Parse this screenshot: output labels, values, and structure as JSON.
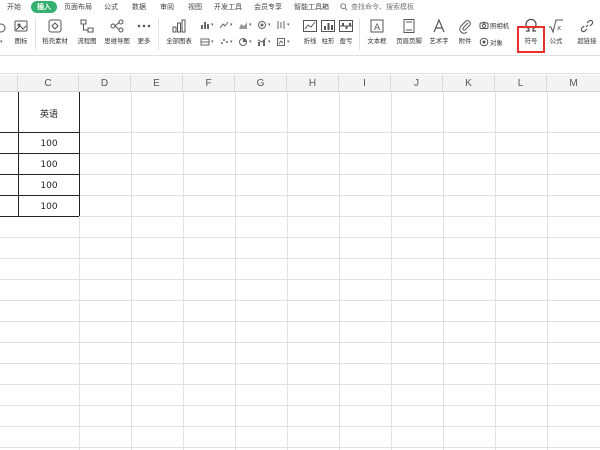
{
  "menu": {
    "tabs": [
      "开始",
      "插入",
      "页面布局",
      "公式",
      "数据",
      "审阅",
      "视图",
      "开发工具",
      "会员专享",
      "智能工具箱"
    ],
    "active_tab": "插入",
    "search_placeholder": "查找命令、搜索模板"
  },
  "ribbon": {
    "icon_label": "图标",
    "daoke": "稻壳素材",
    "flowchart": "流程图",
    "mindmap": "思维导图",
    "more": "更多",
    "all_charts": "全部图表",
    "line": "折线",
    "bar": "柱形",
    "winloss": "盈亏",
    "textbox": "文本框",
    "header_footer": "页眉页脚",
    "wordart": "艺术字",
    "attachment": "附件",
    "camera": "照相机",
    "object": "对象",
    "symbol": "符号",
    "formula": "公式",
    "hyperlink": "超链接"
  },
  "sheet": {
    "columns": [
      "C",
      "D",
      "E",
      "F",
      "G",
      "H",
      "I",
      "J",
      "K",
      "L",
      "M"
    ],
    "header_cell": "英语",
    "values": [
      "100",
      "100",
      "100",
      "100"
    ]
  },
  "colors": {
    "accent": "#34b16e",
    "highlight": "#e8312f"
  }
}
